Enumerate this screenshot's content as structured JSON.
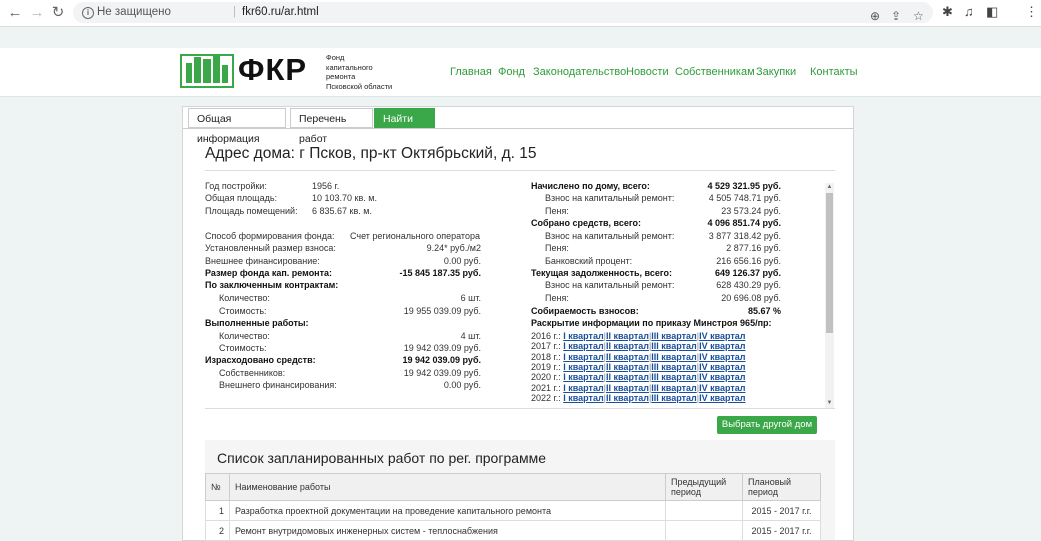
{
  "browser": {
    "security_label": "Не защищено",
    "url": "fkr60.ru/ar.html",
    "info_glyph": "i",
    "back_glyph": "←",
    "forward_glyph": "→",
    "reload_glyph": "↻"
  },
  "site": {
    "logo_text": "ФКР",
    "logo_sub": [
      "Фонд",
      "капитального",
      "ремонта",
      "Псковской области"
    ],
    "nav": [
      "Главная",
      "Фонд",
      "Законодательство",
      "Новости",
      "Собственникам",
      "Закупки",
      "Контакты"
    ]
  },
  "tabs": [
    "Общая информация",
    "Перечень работ",
    "Найти дом"
  ],
  "address_title": "Адрес дома: г Псков, пр-кт Октябрьский, д. 15",
  "left": {
    "build_year_label": "Год постройки:",
    "build_year": "1956 г.",
    "total_area_label": "Общая площадь:",
    "total_area": "10 103.70 кв. м.",
    "rooms_area_label": "Площадь помещений:",
    "rooms_area": "6 835.67 кв. м.",
    "method_label": "Способ формирования фонда:",
    "method": "Счет регионального оператора",
    "fee_label": "Установленный размер взноса:",
    "fee": "9.24* руб./м2",
    "ext_fin_label": "Внешнее финансирование:",
    "ext_fin": "0.00 руб.",
    "fund_size_label": "Размер фонда кап. ремонта:",
    "fund_size": "-15 845 187.35 руб.",
    "contracts_label": "По заключенным контрактам:",
    "contracts_count_label": "Количество:",
    "contracts_count": "6 шт.",
    "contracts_cost_label": "Стоимость:",
    "contracts_cost": "19 955 039.09 руб.",
    "done_label": "Выполненные работы:",
    "done_count_label": "Количество:",
    "done_count": "4 шт.",
    "done_cost_label": "Стоимость:",
    "done_cost": "19 942 039.09 руб.",
    "spent_label": "Израсходовано средств:",
    "spent": "19 942 039.09 руб.",
    "owners_label": "Собственников:",
    "owners": "19 942 039.09 руб.",
    "external_label": "Внешнего финансирования:",
    "external": "0.00 руб."
  },
  "right": {
    "accrued_label": "Начислено по дому, всего:",
    "accrued": "4 529 321.95 руб.",
    "accrued_fee_label": "Взнос на капитальный ремонт:",
    "accrued_fee": "4 505 748.71 руб.",
    "accrued_penalty_label": "Пеня:",
    "accrued_penalty": "23 573.24 руб.",
    "collected_label": "Собрано средств, всего:",
    "collected": "4 096 851.74 руб.",
    "collected_fee_label": "Взнос на капитальный ремонт:",
    "collected_fee": "3 877 318.42 руб.",
    "collected_penalty_label": "Пеня:",
    "collected_penalty": "2 877.16 руб.",
    "bank_label": "Банковский процент:",
    "bank": "216 656.16 руб.",
    "debt_label": "Текущая задолженность, всего:",
    "debt": "649 126.37 руб.",
    "debt_fee_label": "Взнос на капитальный ремонт:",
    "debt_fee": "628 430.29 руб.",
    "debt_penalty_label": "Пеня:",
    "debt_penalty": "20 696.08 руб.",
    "collect_rate_label": "Собираемость взносов:",
    "collect_rate": "85.67 %",
    "disclosure_label": "Раскрытие информации по приказу Минстроя 965/пр:",
    "years": [
      "2016 г.:",
      "2017 г.:",
      "2018 г.:",
      "2019 г.:",
      "2020 г.:",
      "2021 г.:",
      "2022 г.:"
    ],
    "quarters": [
      "I квартал",
      "II квартал",
      "III квартал",
      "IV квартал"
    ],
    "quarter_sep": "|"
  },
  "other_house_button": "Выбрать другой дом",
  "works": {
    "title": "Список запланированных работ по рег. программе",
    "headers": [
      "№",
      "Наименование работы",
      "Предыдущий период",
      "Плановый период"
    ],
    "rows": [
      {
        "num": "1",
        "name": "Разработка проектной документации на проведение капитального ремонта",
        "prev": "",
        "plan": "2015 - 2017 г.г."
      },
      {
        "num": "2",
        "name": "Ремонт внутридомовых инженерных систем - теплоснабжения",
        "prev": "",
        "plan": "2015 - 2017 г.г."
      }
    ]
  },
  "colors": {
    "accent": "#3aa748",
    "link": "#1a4f9c"
  }
}
